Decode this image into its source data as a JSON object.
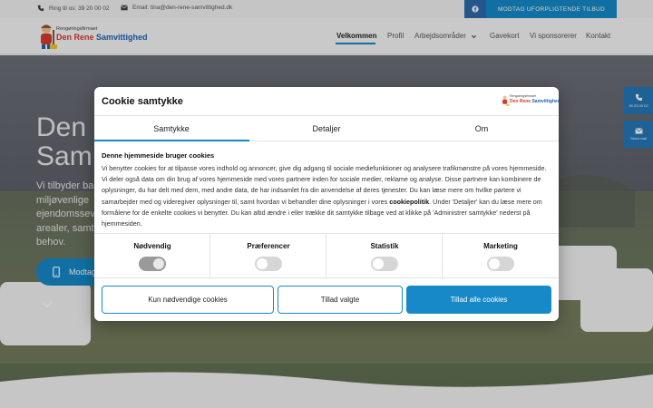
{
  "topbar": {
    "phone": "Ring til os: 39 20 00 02",
    "email": "Email: tina@den-rene-samvittighed.dk",
    "cta": "MODTAG UFORPLIGTENDE TILBUD"
  },
  "logo": {
    "tagline": "Rengøringsfirmaet",
    "name_red": "Den Rene",
    "name_blue": "Samvittighed"
  },
  "nav": {
    "items": [
      "Velkommen",
      "Profil",
      "Arbejdsområder",
      "Gavekort",
      "Vi sponsorerer",
      "Kontakt"
    ]
  },
  "hero": {
    "heading_line1": "Den",
    "heading_line2": "Sam",
    "para": "Vi tilbyder ba miljøvenlige ejendomssev arealer, samt behov.",
    "button": "Modtag"
  },
  "side": {
    "phone_label": "39 20 00 02",
    "mail_label": "Send mail"
  },
  "cookie": {
    "title": "Cookie samtykke",
    "tabs": [
      "Samtykke",
      "Detaljer",
      "Om"
    ],
    "body_title": "Denne hjemmeside bruger cookies",
    "body_part1": "Vi benytter cookies for at tilpasse vores indhold og annoncer, give dig adgang til sociale mediefunktioner og analysere trafikmønstre på vores hjemmeside. Vi deler også data om din brug af vores hjemmeside med vores partnere inden for sociale medier, reklame og analyse. Disse partnere kan kombinere de oplysninger, du har delt med dem, med andre data, de har indsamlet fra din anvendelse af deres tjenester. Du kan læse mere om hvilke partere vi samarbejder med og videregiver oplysninger til, samt hvordan vi behandler dine oplysninger i vores ",
    "body_link": "cookiepolitik",
    "body_part2": ". Under 'Detaljer' kan du læse mere om formålene for de enkelte cookies vi benytter. Du kan altid ændre i eller trække dit samtykke tilbage ved at klikke på 'Administrer samtykke' nederst på hjemmesiden.",
    "categories": [
      "Nødvendig",
      "Præferencer",
      "Statistik",
      "Marketing"
    ],
    "buttons": {
      "necessary_only": "Kun nødvendige cookies",
      "allow_selected": "Tillad valgte",
      "allow_all": "Tillad alle cookies"
    }
  },
  "colors": {
    "accent": "#1788c8",
    "brand_red": "#d63a2f",
    "brand_blue": "#1f63b0"
  }
}
